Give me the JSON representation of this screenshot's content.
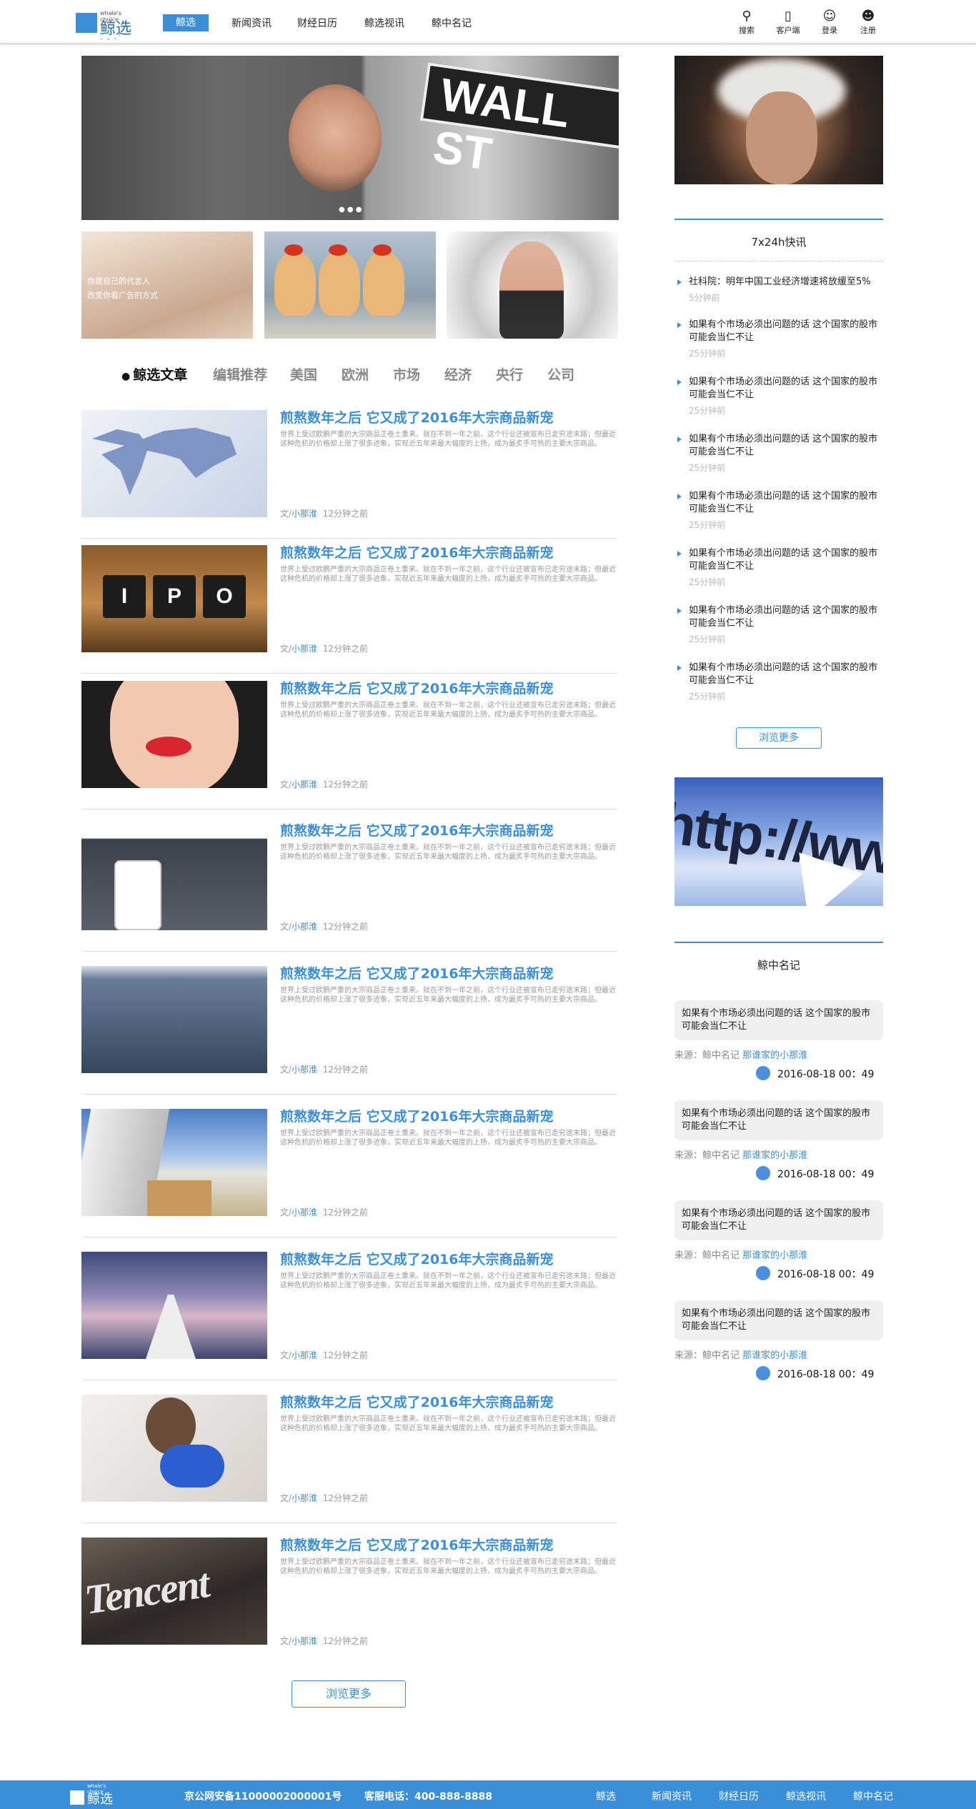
{
  "header": {
    "logo": {
      "en": "whale's choice",
      "cn": "鲸选",
      "sub": "j i n g x u a n"
    },
    "nav": [
      "鲸选",
      "新闻资讯",
      "财经日历",
      "鲸选视讯",
      "鲸中名记"
    ],
    "tools": [
      {
        "icon": "search-icon",
        "label": "搜索"
      },
      {
        "icon": "mobile-icon",
        "label": "客户端"
      },
      {
        "icon": "user-icon",
        "label": "登录"
      },
      {
        "icon": "register-icon",
        "label": "注册"
      }
    ]
  },
  "banner": {
    "sign_text": "WALL ST"
  },
  "thumbs": {
    "t1_lines": [
      "你是自己的代言人",
      "改变你看广告的方式"
    ]
  },
  "tabs": [
    "鲸选文章",
    "编辑推荐",
    "美国",
    "欧洲",
    "市场",
    "经济",
    "央行",
    "公司"
  ],
  "articles": [
    {
      "title": "煎熬数年之后 它又成了2016年大宗商品新宠",
      "summary": "世界上受过欧鹏严重的大宗商品正卷土重来。就在不到一年之前，这个行业还被宣布已走穷途末路；但最近这种危机的价格却上涨了很多迹象，实现近五年来最大幅度的上扬，成为最炙手可热的主要大宗商品。",
      "by": "文/",
      "author": "小那淮",
      "time": "12分钟之前"
    },
    {
      "title": "煎熬数年之后 它又成了2016年大宗商品新宠",
      "summary": "世界上受过欧鹏严重的大宗商品正卷土重来。就在不到一年之前，这个行业还被宣布已走穷途末路；但最近这种危机的价格却上涨了很多迹象，实现近五年来最大幅度的上扬，成为最炙手可热的主要大宗商品。",
      "by": "文/",
      "author": "小那淮",
      "time": "12分钟之前"
    },
    {
      "title": "煎熬数年之后 它又成了2016年大宗商品新宠",
      "summary": "世界上受过欧鹏严重的大宗商品正卷土重来。就在不到一年之前，这个行业还被宣布已走穷途末路；但最近这种危机的价格却上涨了很多迹象，实现近五年来最大幅度的上扬，成为最炙手可热的主要大宗商品。",
      "by": "文/",
      "author": "小那淮",
      "time": "12分钟之前"
    },
    {
      "title": "煎熬数年之后 它又成了2016年大宗商品新宠",
      "summary": "世界上受过欧鹏严重的大宗商品正卷土重来。就在不到一年之前，这个行业还被宣布已走穷途末路；但最近这种危机的价格却上涨了很多迹象，实现近五年来最大幅度的上扬，成为最炙手可热的主要大宗商品。",
      "by": "文/",
      "author": "小那淮",
      "time": "12分钟之前"
    },
    {
      "title": "煎熬数年之后 它又成了2016年大宗商品新宠",
      "summary": "世界上受过欧鹏严重的大宗商品正卷土重来。就在不到一年之前，这个行业还被宣布已走穷途末路；但最近这种危机的价格却上涨了很多迹象，实现近五年来最大幅度的上扬，成为最炙手可热的主要大宗商品。",
      "by": "文/",
      "author": "小那淮",
      "time": "12分钟之前"
    },
    {
      "title": "煎熬数年之后 它又成了2016年大宗商品新宠",
      "summary": "世界上受过欧鹏严重的大宗商品正卷土重来。就在不到一年之前，这个行业还被宣布已走穷途末路；但最近这种危机的价格却上涨了很多迹象，实现近五年来最大幅度的上扬，成为最炙手可热的主要大宗商品。",
      "by": "文/",
      "author": "小那淮",
      "time": "12分钟之前"
    },
    {
      "title": "煎熬数年之后 它又成了2016年大宗商品新宠",
      "summary": "世界上受过欧鹏严重的大宗商品正卷土重来。就在不到一年之前，这个行业还被宣布已走穷途末路；但最近这种危机的价格却上涨了很多迹象，实现近五年来最大幅度的上扬，成为最炙手可热的主要大宗商品。",
      "by": "文/",
      "author": "小那淮",
      "time": "12分钟之前"
    },
    {
      "title": "煎熬数年之后 它又成了2016年大宗商品新宠",
      "summary": "世界上受过欧鹏严重的大宗商品正卷土重来。就在不到一年之前，这个行业还被宣布已走穷途末路；但最近这种危机的价格却上涨了很多迹象，实现近五年来最大幅度的上扬，成为最炙手可热的主要大宗商品。",
      "by": "文/",
      "author": "小那淮",
      "time": "12分钟之前"
    },
    {
      "title": "煎熬数年之后 它又成了2016年大宗商品新宠",
      "summary": "世界上受过欧鹏严重的大宗商品正卷土重来。就在不到一年之前，这个行业还被宣布已走穷途末路；但最近这种危机的价格却上涨了很多迹象，实现近五年来最大幅度的上扬，成为最炙手可热的主要大宗商品。",
      "by": "文/",
      "author": "小那淮",
      "time": "12分钟之前"
    }
  ],
  "article_images": [
    "IPO",
    "Tencent"
  ],
  "more_button": "浏览更多",
  "sidebar": {
    "flash_title": "7x24h快讯",
    "flash": [
      {
        "text": "社科院：明年中国工业经济增速将放缓至5%",
        "time": "5分钟前"
      },
      {
        "text": "如果有个市场必须出问题的话 这个国家的股市可能会当仁不让",
        "time": "25分钟前"
      },
      {
        "text": "如果有个市场必须出问题的话 这个国家的股市可能会当仁不让",
        "time": "25分钟前"
      },
      {
        "text": "如果有个市场必须出问题的话 这个国家的股市可能会当仁不让",
        "time": "25分钟前"
      },
      {
        "text": "如果有个市场必须出问题的话 这个国家的股市可能会当仁不让",
        "time": "25分钟前"
      },
      {
        "text": "如果有个市场必须出问题的话 这个国家的股市可能会当仁不让",
        "time": "25分钟前"
      },
      {
        "text": "如果有个市场必须出问题的话 这个国家的股市可能会当仁不让",
        "time": "25分钟前"
      },
      {
        "text": "如果有个市场必须出问题的话 这个国家的股市可能会当仁不让",
        "time": "25分钟前"
      }
    ],
    "flash_more": "浏览更多",
    "url_text": "http://ww",
    "quotes_title": "鲸中名记",
    "quotes": [
      {
        "text": "如果有个市场必须出问题的话 这个国家的股市可能会当仁不让",
        "src_label": "来源：鲸中名记",
        "author": "那谁家的小那淮",
        "date": "2016-08-18 00：49"
      },
      {
        "text": "如果有个市场必须出问题的话 这个国家的股市可能会当仁不让",
        "src_label": "来源：鲸中名记",
        "author": "那谁家的小那淮",
        "date": "2016-08-18 00：49"
      },
      {
        "text": "如果有个市场必须出问题的话 这个国家的股市可能会当仁不让",
        "src_label": "来源：鲸中名记",
        "author": "那谁家的小那淮",
        "date": "2016-08-18 00：49"
      },
      {
        "text": "如果有个市场必须出问题的话 这个国家的股市可能会当仁不让",
        "src_label": "来源：鲸中名记",
        "author": "那谁家的小那淮",
        "date": "2016-08-18 00：49"
      }
    ]
  },
  "footer": {
    "logo_en": "whale's choice",
    "logo_cn": "鲸选",
    "icp": "京公网安备11000002000001号",
    "phone": "客服电话：400-888-8888",
    "nav": [
      "鲸选",
      "新闻资讯",
      "财经日历",
      "鲸选视讯",
      "鲸中名记"
    ]
  },
  "colors": {
    "accent": "#3b8fd8"
  }
}
